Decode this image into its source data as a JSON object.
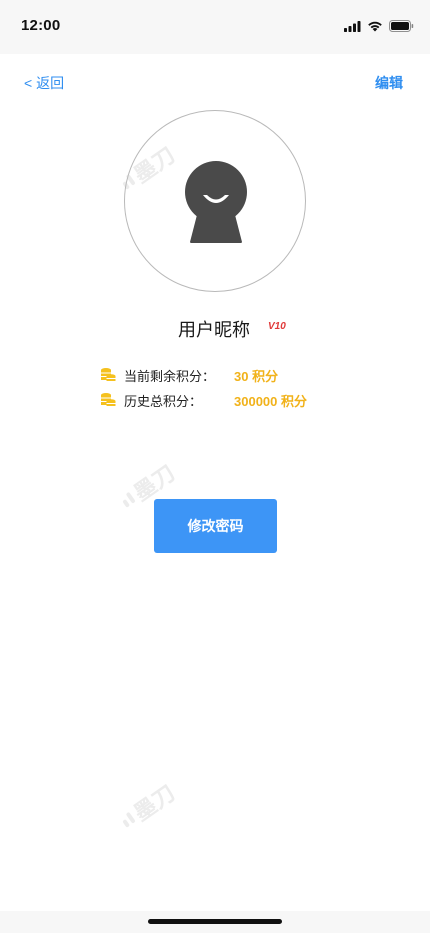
{
  "status_bar": {
    "time": "12:00",
    "icons": [
      "cellular-signal-icon",
      "wifi-icon",
      "battery-icon"
    ]
  },
  "nav": {
    "back_label": "< 返回",
    "edit_label": "编辑"
  },
  "profile": {
    "avatar_icon": "user-avatar-icon",
    "nickname": "用户昵称",
    "vip_level": "V10"
  },
  "points": {
    "current_label": "当前剩余积分：",
    "current_value": "30 积分",
    "total_label": "历史总积分：",
    "total_value": "300000 积分",
    "icon": "coin-stack-icon"
  },
  "actions": {
    "change_password_label": "修改密码"
  },
  "watermark": {
    "text": "墨刀"
  },
  "colors": {
    "accent": "#2f8ef0",
    "button": "#3d95f6",
    "points": "#f1b21a",
    "vip": "#e03a3a"
  }
}
